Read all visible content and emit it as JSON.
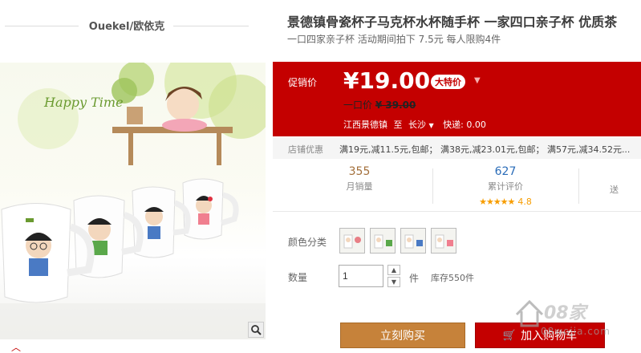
{
  "brand": {
    "name": "Ouekel/欧依克"
  },
  "product": {
    "title": "景德镇骨瓷杯子马克杯水杯随手杯 一家四口亲子杯 优质茶",
    "subtitle": "一口四家亲子杯 活动期间拍下 7.5元 每人限购4件",
    "image_text": "Happy Time"
  },
  "price_panel": {
    "promo_label": "促销价",
    "price": "¥19.00",
    "tag": "大特价",
    "original_label": "一口价",
    "original_price": "¥ 39.00",
    "ship_from": "江西景德镇",
    "to_word": "至",
    "ship_to": "长沙",
    "express": "快递: 0.00"
  },
  "coupon": {
    "label": "店铺优惠",
    "text": "满19元,减11.5元,包邮； 满38元,减23.01元,包邮； 满57元,减34.52元..."
  },
  "stats": {
    "monthly_sales_value": "355",
    "monthly_sales_label": "月销量",
    "reviews_value": "627",
    "reviews_label": "累计评价",
    "rating": "4.8",
    "stars": "★★★★★",
    "third_label": "送"
  },
  "options": {
    "color_label": "颜色分类",
    "qty_label": "数量",
    "qty_value": "1",
    "unit": "件",
    "stock": "库存550件"
  },
  "actions": {
    "buy": "立刻购买",
    "cart": "加入购物车"
  },
  "watermark": {
    "text": "08家",
    "url": "08wojia.com"
  },
  "colors": {
    "accent_red": "#c40000",
    "buy_brown": "#c6823a",
    "sales_brown": "#a36f3a",
    "review_blue": "#2a6cb8",
    "star_orange": "#f79d00"
  }
}
